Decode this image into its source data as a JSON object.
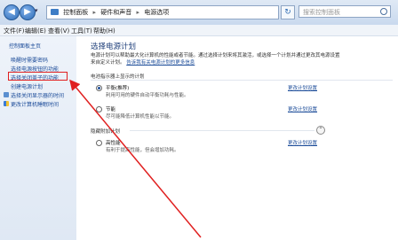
{
  "addressbar": {
    "back_glyph": "◀",
    "forward_glyph": "▶",
    "recent_glyph": "▾",
    "crumbs": [
      "控制面板",
      "硬件和声音",
      "电源选项"
    ],
    "separator": "▸",
    "refresh_glyph": "↻",
    "search_placeholder": "搜索控制面板"
  },
  "menubar": {
    "items": [
      "文件(F)",
      "编辑(E)",
      "查看(V)",
      "工具(T)",
      "帮助(H)"
    ]
  },
  "sidebar": {
    "home_link": "控制面板主页",
    "links": [
      "唤醒时需要密码",
      "选择电源按钮的功能",
      "选择关闭盖子的功能",
      "创建电源计划",
      "选择关闭显示器的时间",
      "更改计算机睡眠时间"
    ]
  },
  "main": {
    "title": "选择电源计划",
    "desc_line1": "电源计划可以帮助最大化计算机的性能或者节能。通过选择计划来将其激活，或选择一个计划并通过更改其电源设置",
    "desc_line2_prefix": "来自定义计划。",
    "desc_link": "告诉我有关电源计划的更多信息",
    "section_label": "电池指示器上显示的计划",
    "hidden_section_label": "隐藏附加计划",
    "expand_glyph": "⌃",
    "plans": [
      {
        "name": "平衡(推荐)",
        "desc": "利用可用的硬件自动平衡功耗与性能。",
        "link": "更改计划设置",
        "selected": true
      },
      {
        "name": "节能",
        "desc": "尽可能降低计算机性能以节能。",
        "link": "更改计划设置",
        "selected": false
      },
      {
        "name": "高性能",
        "desc": "有利于提高性能，但会增加功耗。",
        "link": "更改计划设置",
        "selected": false
      }
    ]
  },
  "colors": {
    "annotation_red": "#e02020",
    "link_blue": "#1c4c99"
  }
}
